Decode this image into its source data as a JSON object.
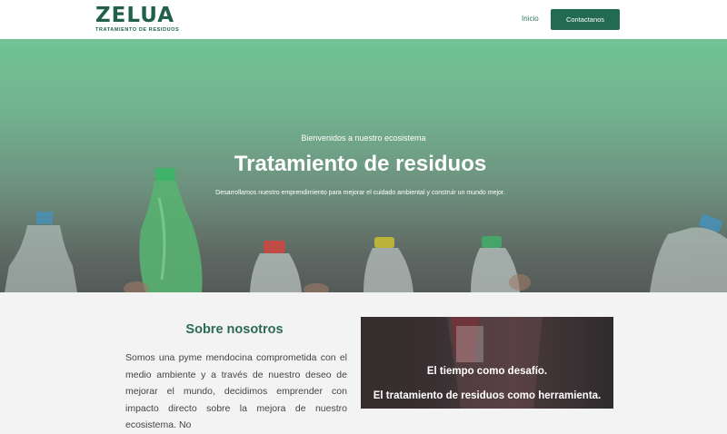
{
  "header": {
    "logo": {
      "word": "ZELUA",
      "tagline": "TRATAMIENTO DE RESIDUOS"
    },
    "nav": {
      "home_label": "Inicio"
    },
    "cta_label": "Contactanos"
  },
  "hero": {
    "eyebrow": "Bienvenidos a nuestro ecosistema",
    "title": "Tratamiento de residuos",
    "subtitle": "Desarrollamos nuestro emprendimiento para mejorar el cuidado ambiental y construir un mundo mejor."
  },
  "about": {
    "title": "Sobre nosotros",
    "text": "Somos una pyme mendocina comprometida con el medio ambiente y a través de nuestro deseo de mejorar el mundo, decidimos emprender con impacto directo sobre la mejora de nuestro ecosistema. No"
  },
  "promo": {
    "line1": "El tiempo como desafío.",
    "line2": "El tratamiento de residuos como herramienta."
  },
  "colors": {
    "brand_green": "#21614b",
    "button_green": "#236a52",
    "hero_top": "#71c395",
    "hero_bottom": "#545b58"
  }
}
